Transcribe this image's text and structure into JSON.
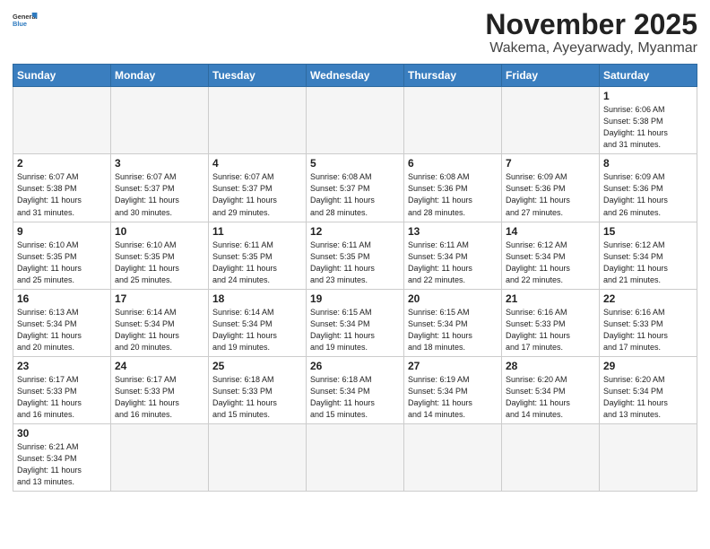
{
  "logo": {
    "text_general": "General",
    "text_blue": "Blue"
  },
  "title": "November 2025",
  "subtitle": "Wakema, Ayeyarwady, Myanmar",
  "weekdays": [
    "Sunday",
    "Monday",
    "Tuesday",
    "Wednesday",
    "Thursday",
    "Friday",
    "Saturday"
  ],
  "weeks": [
    [
      {
        "day": "",
        "info": ""
      },
      {
        "day": "",
        "info": ""
      },
      {
        "day": "",
        "info": ""
      },
      {
        "day": "",
        "info": ""
      },
      {
        "day": "",
        "info": ""
      },
      {
        "day": "",
        "info": ""
      },
      {
        "day": "1",
        "info": "Sunrise: 6:06 AM\nSunset: 5:38 PM\nDaylight: 11 hours\nand 31 minutes."
      }
    ],
    [
      {
        "day": "2",
        "info": "Sunrise: 6:07 AM\nSunset: 5:38 PM\nDaylight: 11 hours\nand 31 minutes."
      },
      {
        "day": "3",
        "info": "Sunrise: 6:07 AM\nSunset: 5:37 PM\nDaylight: 11 hours\nand 30 minutes."
      },
      {
        "day": "4",
        "info": "Sunrise: 6:07 AM\nSunset: 5:37 PM\nDaylight: 11 hours\nand 29 minutes."
      },
      {
        "day": "5",
        "info": "Sunrise: 6:08 AM\nSunset: 5:37 PM\nDaylight: 11 hours\nand 28 minutes."
      },
      {
        "day": "6",
        "info": "Sunrise: 6:08 AM\nSunset: 5:36 PM\nDaylight: 11 hours\nand 28 minutes."
      },
      {
        "day": "7",
        "info": "Sunrise: 6:09 AM\nSunset: 5:36 PM\nDaylight: 11 hours\nand 27 minutes."
      },
      {
        "day": "8",
        "info": "Sunrise: 6:09 AM\nSunset: 5:36 PM\nDaylight: 11 hours\nand 26 minutes."
      }
    ],
    [
      {
        "day": "9",
        "info": "Sunrise: 6:10 AM\nSunset: 5:35 PM\nDaylight: 11 hours\nand 25 minutes."
      },
      {
        "day": "10",
        "info": "Sunrise: 6:10 AM\nSunset: 5:35 PM\nDaylight: 11 hours\nand 25 minutes."
      },
      {
        "day": "11",
        "info": "Sunrise: 6:11 AM\nSunset: 5:35 PM\nDaylight: 11 hours\nand 24 minutes."
      },
      {
        "day": "12",
        "info": "Sunrise: 6:11 AM\nSunset: 5:35 PM\nDaylight: 11 hours\nand 23 minutes."
      },
      {
        "day": "13",
        "info": "Sunrise: 6:11 AM\nSunset: 5:34 PM\nDaylight: 11 hours\nand 22 minutes."
      },
      {
        "day": "14",
        "info": "Sunrise: 6:12 AM\nSunset: 5:34 PM\nDaylight: 11 hours\nand 22 minutes."
      },
      {
        "day": "15",
        "info": "Sunrise: 6:12 AM\nSunset: 5:34 PM\nDaylight: 11 hours\nand 21 minutes."
      }
    ],
    [
      {
        "day": "16",
        "info": "Sunrise: 6:13 AM\nSunset: 5:34 PM\nDaylight: 11 hours\nand 20 minutes."
      },
      {
        "day": "17",
        "info": "Sunrise: 6:14 AM\nSunset: 5:34 PM\nDaylight: 11 hours\nand 20 minutes."
      },
      {
        "day": "18",
        "info": "Sunrise: 6:14 AM\nSunset: 5:34 PM\nDaylight: 11 hours\nand 19 minutes."
      },
      {
        "day": "19",
        "info": "Sunrise: 6:15 AM\nSunset: 5:34 PM\nDaylight: 11 hours\nand 19 minutes."
      },
      {
        "day": "20",
        "info": "Sunrise: 6:15 AM\nSunset: 5:34 PM\nDaylight: 11 hours\nand 18 minutes."
      },
      {
        "day": "21",
        "info": "Sunrise: 6:16 AM\nSunset: 5:33 PM\nDaylight: 11 hours\nand 17 minutes."
      },
      {
        "day": "22",
        "info": "Sunrise: 6:16 AM\nSunset: 5:33 PM\nDaylight: 11 hours\nand 17 minutes."
      }
    ],
    [
      {
        "day": "23",
        "info": "Sunrise: 6:17 AM\nSunset: 5:33 PM\nDaylight: 11 hours\nand 16 minutes."
      },
      {
        "day": "24",
        "info": "Sunrise: 6:17 AM\nSunset: 5:33 PM\nDaylight: 11 hours\nand 16 minutes."
      },
      {
        "day": "25",
        "info": "Sunrise: 6:18 AM\nSunset: 5:33 PM\nDaylight: 11 hours\nand 15 minutes."
      },
      {
        "day": "26",
        "info": "Sunrise: 6:18 AM\nSunset: 5:34 PM\nDaylight: 11 hours\nand 15 minutes."
      },
      {
        "day": "27",
        "info": "Sunrise: 6:19 AM\nSunset: 5:34 PM\nDaylight: 11 hours\nand 14 minutes."
      },
      {
        "day": "28",
        "info": "Sunrise: 6:20 AM\nSunset: 5:34 PM\nDaylight: 11 hours\nand 14 minutes."
      },
      {
        "day": "29",
        "info": "Sunrise: 6:20 AM\nSunset: 5:34 PM\nDaylight: 11 hours\nand 13 minutes."
      }
    ],
    [
      {
        "day": "30",
        "info": "Sunrise: 6:21 AM\nSunset: 5:34 PM\nDaylight: 11 hours\nand 13 minutes."
      },
      {
        "day": "",
        "info": ""
      },
      {
        "day": "",
        "info": ""
      },
      {
        "day": "",
        "info": ""
      },
      {
        "day": "",
        "info": ""
      },
      {
        "day": "",
        "info": ""
      },
      {
        "day": "",
        "info": ""
      }
    ]
  ]
}
